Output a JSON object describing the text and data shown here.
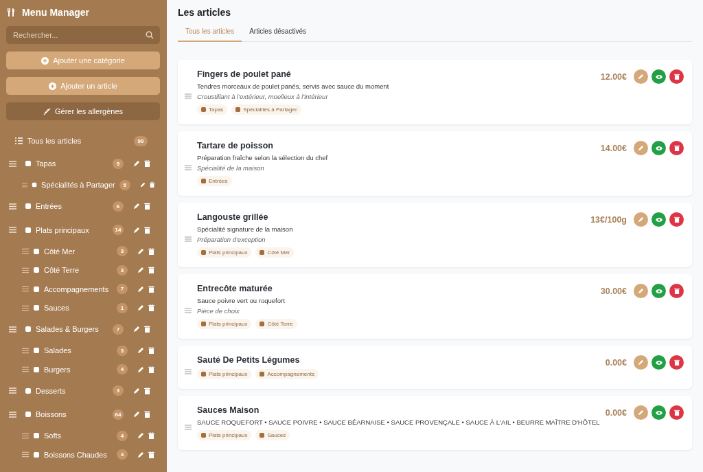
{
  "sidebar": {
    "title": "Menu Manager",
    "search": {
      "placeholder": "Rechercher..."
    },
    "buttons": [
      {
        "label": "Ajouter une catégorie",
        "kind": "add"
      },
      {
        "label": "Ajouter un article",
        "kind": "add"
      },
      {
        "label": "Gérer les allergènes",
        "kind": "manage"
      }
    ],
    "all_items": {
      "label": "Tous les articles",
      "count": "99"
    },
    "categories": [
      {
        "name": "Tapas",
        "count": "5",
        "children": [
          {
            "name": "Spécialités à Partager",
            "count": "5"
          }
        ]
      },
      {
        "name": "Entrées",
        "count": "6"
      },
      {
        "name": "Plats principaux",
        "count": "14",
        "children": [
          {
            "name": "Côté Mer",
            "count": "3"
          },
          {
            "name": "Côté Terre",
            "count": "3"
          },
          {
            "name": "Accompagnements",
            "count": "7"
          },
          {
            "name": "Sauces",
            "count": "1"
          }
        ]
      },
      {
        "name": "Salades & Burgers",
        "count": "7",
        "children": [
          {
            "name": "Salades",
            "count": "3"
          },
          {
            "name": "Burgers",
            "count": "4"
          }
        ]
      },
      {
        "name": "Desserts",
        "count": "3"
      },
      {
        "name": "Boissons",
        "count": "64",
        "children": [
          {
            "name": "Softs",
            "count": "4"
          },
          {
            "name": "Boissons Chaudes",
            "count": "4"
          }
        ]
      }
    ]
  },
  "main": {
    "title": "Les articles",
    "tabs": [
      {
        "label": "Tous les articles",
        "selected": true
      },
      {
        "label": "Articles désactivés",
        "selected": false
      }
    ],
    "articles": [
      {
        "name": "Fingers de poulet pané",
        "description": "Tendres morceaux de poulet panés, servis avec sauce du moment",
        "note": "Croustillant à l'extérieur, moelleux à l'intérieur",
        "price": "12.00€",
        "tags": [
          "Tapas",
          "Spécialités à Partager"
        ]
      },
      {
        "name": "Tartare de poisson",
        "description": "Préparation fraîche selon la sélection du chef",
        "note": "Spécialité de la maison",
        "price": "14.00€",
        "tags": [
          "Entrées"
        ]
      },
      {
        "name": "Langouste grillée",
        "description": "Spécialité signature de la maison",
        "note": "Préparation d'exception",
        "price": "13€/100g",
        "tags": [
          "Plats principaux",
          "Côté Mer"
        ]
      },
      {
        "name": "Entrecôte maturée",
        "description": "Sauce poivre vert ou roquefort",
        "note": "Pièce de choix",
        "price": "30.00€",
        "tags": [
          "Plats principaux",
          "Côté Terre"
        ]
      },
      {
        "name": "Sauté De Petits Légumes",
        "price": "0.00€",
        "tags": [
          "Plats principaux",
          "Accompagnements"
        ]
      },
      {
        "name": "Sauces Maison",
        "description": "SAUCE ROQUEFORT • SAUCE POIVRE • SAUCE BÉARNAISE • SAUCE PROVENÇALE • SAUCE À L'AIL • BEURRE MAÎTRE D'HÔTEL",
        "price": "0.00€",
        "tags": [
          "Plats principaux",
          "Sauces"
        ]
      }
    ]
  }
}
